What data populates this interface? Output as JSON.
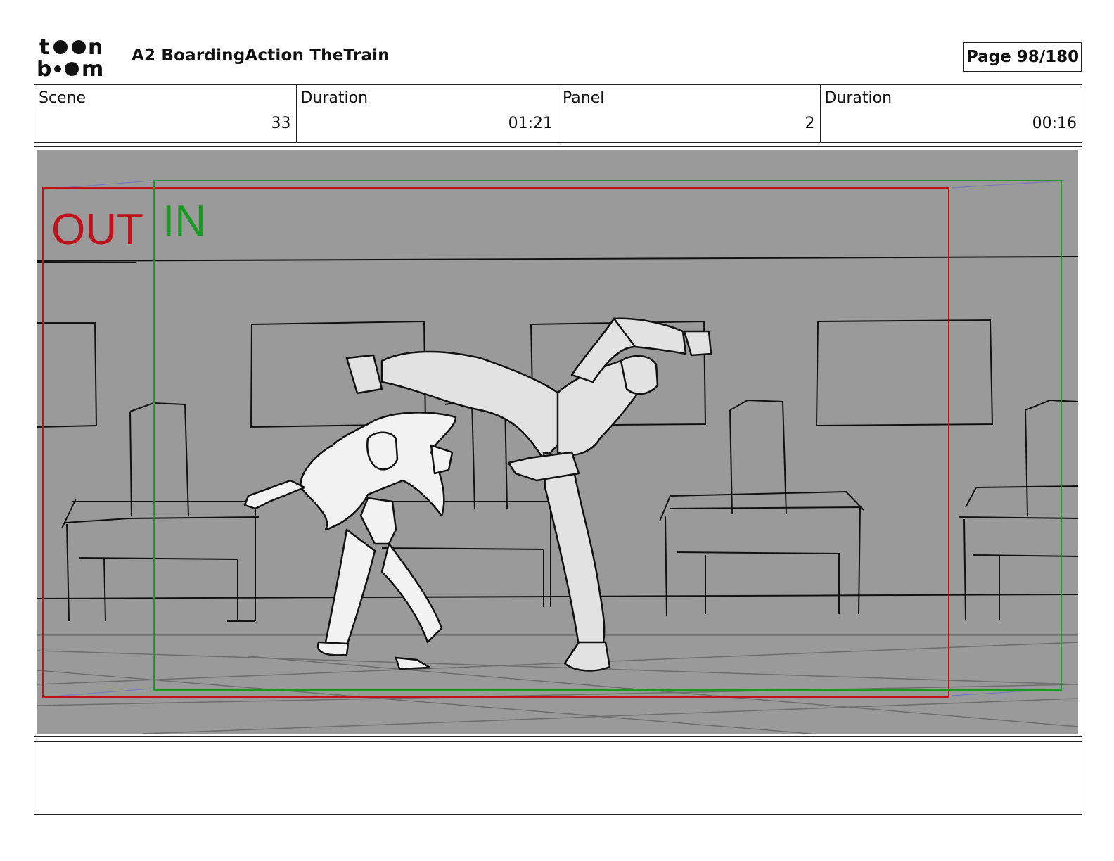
{
  "header": {
    "logo_text_top": "toon",
    "logo_text_bottom": "boom",
    "project_title": "A2 BoardingAction TheTrain",
    "page_label": "Page",
    "page_value": "98/180"
  },
  "info": {
    "scene_label": "Scene",
    "scene_value": "33",
    "scene_duration_label": "Duration",
    "scene_duration_value": "01:21",
    "panel_label": "Panel",
    "panel_value": "2",
    "panel_duration_label": "Duration",
    "panel_duration_value": "00:16"
  },
  "panel": {
    "out_label": "OUT",
    "in_label": "IN",
    "out_color": "#c0121c",
    "in_color": "#1a9a22",
    "background_color": "#9a9a9a"
  },
  "notes": {
    "text": ""
  }
}
